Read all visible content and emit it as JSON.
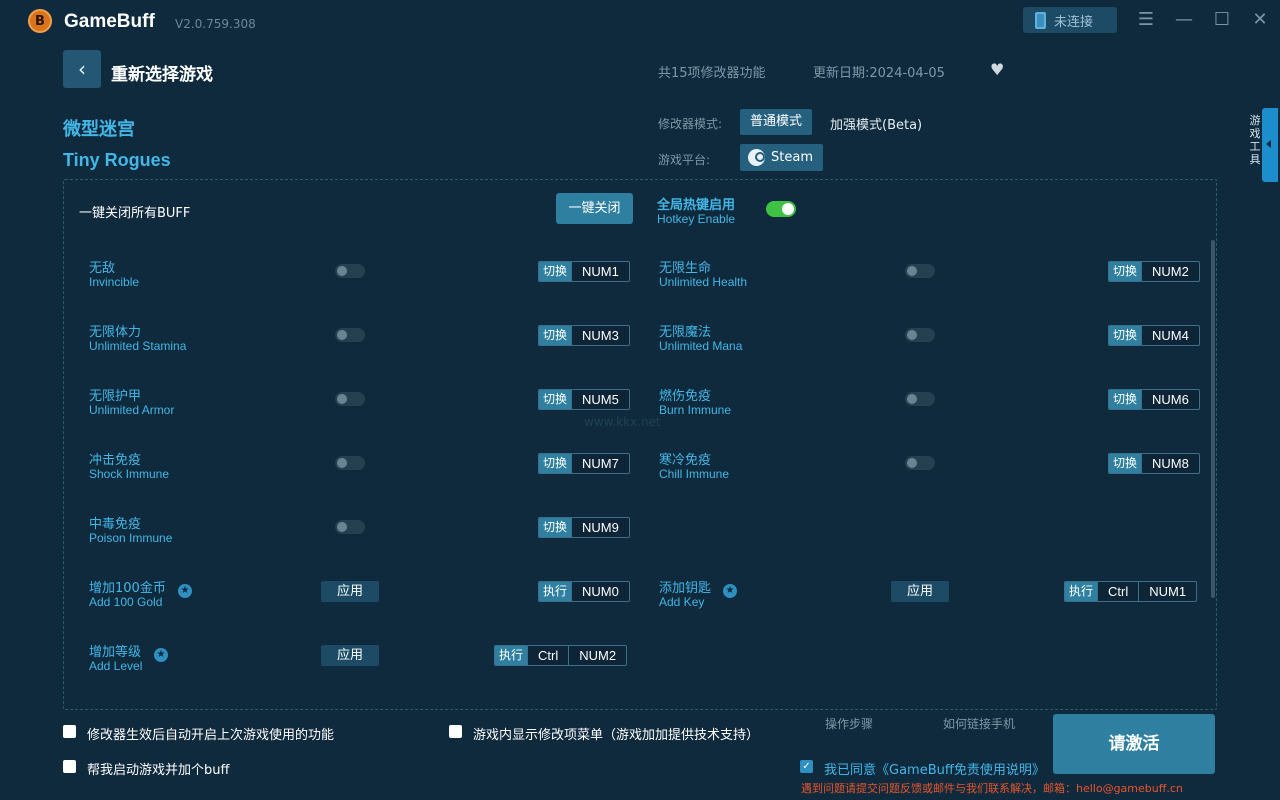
{
  "app": {
    "name": "GameBuff",
    "version": "V2.0.759.308",
    "connect_label": "未连接"
  },
  "header": {
    "title": "重新选择游戏",
    "count_text": "共15项修改器功能",
    "update_text": "更新日期:2024-04-05"
  },
  "game": {
    "name_cn": "微型迷宫",
    "name_en": "Tiny Rogues"
  },
  "mode": {
    "label": "修改器模式:",
    "normal": "普通模式",
    "enhanced": "加强模式(Beta)"
  },
  "platform": {
    "label": "游戏平台:",
    "name": "Steam"
  },
  "sidetab": "游戏工具",
  "controls": {
    "close_all_label": "一键关闭所有BUFF",
    "close_btn": "一键关闭",
    "hotkey_cn": "全局热键启用",
    "hotkey_en": "Hotkey Enable",
    "hotkey_enabled": true
  },
  "toggles": [
    {
      "cn": "无敌",
      "en": "Invincible",
      "action": "切换",
      "key": "NUM1"
    },
    {
      "cn": "无限生命",
      "en": "Unlimited Health",
      "action": "切换",
      "key": "NUM2"
    },
    {
      "cn": "无限体力",
      "en": "Unlimited Stamina",
      "action": "切换",
      "key": "NUM3"
    },
    {
      "cn": "无限魔法",
      "en": "Unlimited Mana",
      "action": "切换",
      "key": "NUM4"
    },
    {
      "cn": "无限护甲",
      "en": "Unlimited Armor",
      "action": "切换",
      "key": "NUM5"
    },
    {
      "cn": "燃伤免疫",
      "en": "Burn Immune",
      "action": "切换",
      "key": "NUM6"
    },
    {
      "cn": "冲击免疫",
      "en": "Shock Immune",
      "action": "切换",
      "key": "NUM7"
    },
    {
      "cn": "寒冷免疫",
      "en": "Chill Immune",
      "action": "切换",
      "key": "NUM8"
    },
    {
      "cn": "中毒免疫",
      "en": "Poison Immune",
      "action": "切换",
      "key": "NUM9"
    }
  ],
  "applies": [
    {
      "cn": "增加100金币",
      "en": "Add 100 Gold",
      "apply": "应用",
      "action": "执行",
      "mod": "",
      "key": "NUM0"
    },
    {
      "cn": "添加钥匙",
      "en": "Add Key",
      "apply": "应用",
      "action": "执行",
      "mod": "Ctrl",
      "key": "NUM1"
    },
    {
      "cn": "增加等级",
      "en": "Add Level",
      "apply": "应用",
      "action": "执行",
      "mod": "Ctrl",
      "key": "NUM2"
    }
  ],
  "footer": {
    "opt1": "修改器生效后自动开启上次游戏使用的功能",
    "opt2": "游戏内显示修改项菜单（游戏加加提供技术支持）",
    "opt3": "帮我启动游戏并加个buff",
    "steps": "操作步骤",
    "phone": "如何链接手机",
    "activate": "请激活",
    "agree": "我已同意《GameBuff免责使用说明》",
    "notice": "遇到问题请提交问题反馈或邮件与我们联系解决，邮箱：hello@gamebuff.cn"
  },
  "watermark": "www.kkx.net",
  "colors": {
    "background": "#0f2a3d",
    "accent": "#43b6e6",
    "button": "#2f7fa1",
    "toggle_on": "#3ec243",
    "notice": "#e8552b"
  }
}
